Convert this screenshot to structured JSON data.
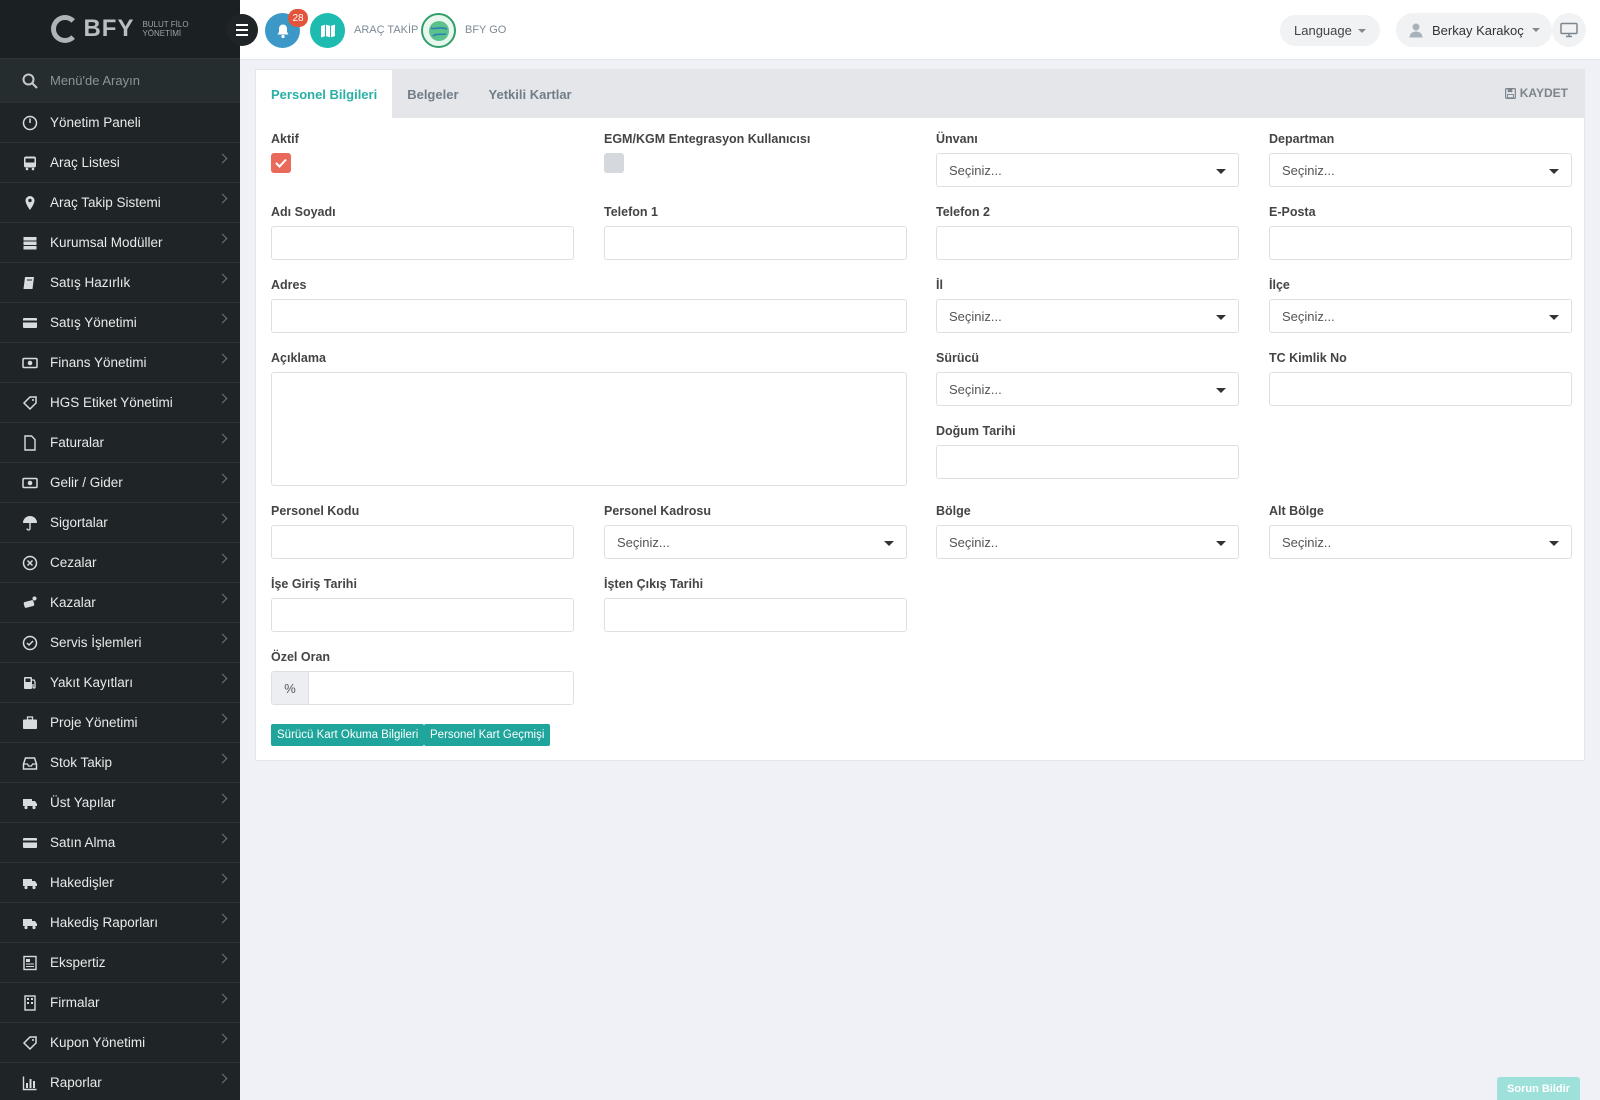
{
  "logo": {
    "text": "BFY",
    "sub_line1": "BULUT FİLO",
    "sub_line2": "YÖNETİMİ"
  },
  "sidebar": {
    "search_placeholder": "Menü'de Arayın",
    "items": [
      {
        "label": "Yönetim Paneli",
        "icon": "dashboard-icon",
        "chevron": false
      },
      {
        "label": "Araç Listesi",
        "icon": "bus-icon",
        "chevron": true
      },
      {
        "label": "Araç Takip Sistemi",
        "icon": "map-pin-icon",
        "chevron": true
      },
      {
        "label": "Kurumsal Modüller",
        "icon": "server-icon",
        "chevron": true
      },
      {
        "label": "Satış Hazırlık",
        "icon": "book-icon",
        "chevron": true
      },
      {
        "label": "Satış Yönetimi",
        "icon": "card-icon",
        "chevron": true
      },
      {
        "label": "Finans Yönetimi",
        "icon": "money-icon",
        "chevron": true
      },
      {
        "label": "HGS Etiket Yönetimi",
        "icon": "tag-icon",
        "chevron": true
      },
      {
        "label": "Faturalar",
        "icon": "file-icon",
        "chevron": true
      },
      {
        "label": "Gelir / Gider",
        "icon": "money-icon",
        "chevron": true
      },
      {
        "label": "Sigortalar",
        "icon": "umbrella-icon",
        "chevron": true
      },
      {
        "label": "Cezalar",
        "icon": "x-circle-icon",
        "chevron": true
      },
      {
        "label": "Kazalar",
        "icon": "car-crash-icon",
        "chevron": true
      },
      {
        "label": "Servis İşlemleri",
        "icon": "check-circle-icon",
        "chevron": true
      },
      {
        "label": "Yakıt Kayıtları",
        "icon": "fuel-icon",
        "chevron": true
      },
      {
        "label": "Proje Yönetimi",
        "icon": "briefcase-icon",
        "chevron": true
      },
      {
        "label": "Stok Takip",
        "icon": "inbox-icon",
        "chevron": true
      },
      {
        "label": "Üst Yapılar",
        "icon": "truck-icon",
        "chevron": true
      },
      {
        "label": "Satın Alma",
        "icon": "card-icon",
        "chevron": true
      },
      {
        "label": "Hakedişler",
        "icon": "truck-icon",
        "chevron": true
      },
      {
        "label": "Hakediş Raporları",
        "icon": "truck-icon",
        "chevron": true
      },
      {
        "label": "Ekspertiz",
        "icon": "newspaper-icon",
        "chevron": true
      },
      {
        "label": "Firmalar",
        "icon": "building-icon",
        "chevron": true
      },
      {
        "label": "Kupon Yönetimi",
        "icon": "tag-icon",
        "chevron": true
      },
      {
        "label": "Raporlar",
        "icon": "bar-chart-icon",
        "chevron": true
      }
    ]
  },
  "topbar": {
    "notification_count": "28",
    "arac_takip_label": "ARAÇ TAKİP",
    "bfy_go_label": "BFY GO",
    "language_label": "Language",
    "user_name": "Berkay Karakoç"
  },
  "tabs": [
    "Personel Bilgileri",
    "Belgeler",
    "Yetkili Kartlar"
  ],
  "save_label": "KAYDET",
  "form": {
    "aktif": {
      "label": "Aktif",
      "checked": true
    },
    "egm": {
      "label": "EGM/KGM Entegrasyon Kullanıcısı",
      "checked": false
    },
    "unvan": {
      "label": "Ünvanı",
      "value": "Seçiniz..."
    },
    "departman": {
      "label": "Departman",
      "value": "Seçiniz..."
    },
    "adi_soyadi": {
      "label": "Adı Soyadı",
      "value": ""
    },
    "telefon1": {
      "label": "Telefon 1",
      "value": ""
    },
    "telefon2": {
      "label": "Telefon 2",
      "value": ""
    },
    "eposta": {
      "label": "E-Posta",
      "value": ""
    },
    "adres": {
      "label": "Adres",
      "value": ""
    },
    "il": {
      "label": "İl",
      "value": "Seçiniz..."
    },
    "ilce": {
      "label": "İlçe",
      "value": "Seçiniz..."
    },
    "aciklama": {
      "label": "Açıklama",
      "value": ""
    },
    "surucu": {
      "label": "Sürücü",
      "value": "Seçiniz..."
    },
    "tc": {
      "label": "TC Kimlik No",
      "value": ""
    },
    "dogum": {
      "label": "Doğum Tarihi",
      "value": ""
    },
    "personel_kodu": {
      "label": "Personel Kodu",
      "value": ""
    },
    "kadro": {
      "label": "Personel Kadrosu",
      "value": "Seçiniz..."
    },
    "bolge": {
      "label": "Bölge",
      "value": "Seçiniz.."
    },
    "alt_bolge": {
      "label": "Alt Bölge",
      "value": "Seçiniz.."
    },
    "giris": {
      "label": "İşe Giriş Tarihi",
      "value": ""
    },
    "cikis": {
      "label": "İşten Çıkış Tarihi",
      "value": ""
    },
    "ozel_oran": {
      "label": "Özel Oran",
      "addon": "%",
      "value": ""
    }
  },
  "buttons": {
    "surucu_kart": "Sürücü Kart Okuma Bilgileri",
    "personel_kart": "Personel Kart Geçmişi"
  },
  "report_button": "Sorun Bildir",
  "colors": {
    "accent": "#2bb0a5",
    "sidebar_bg": "#1f2527",
    "checkbox_on": "#e96a5a",
    "badge": "#e2543b"
  }
}
